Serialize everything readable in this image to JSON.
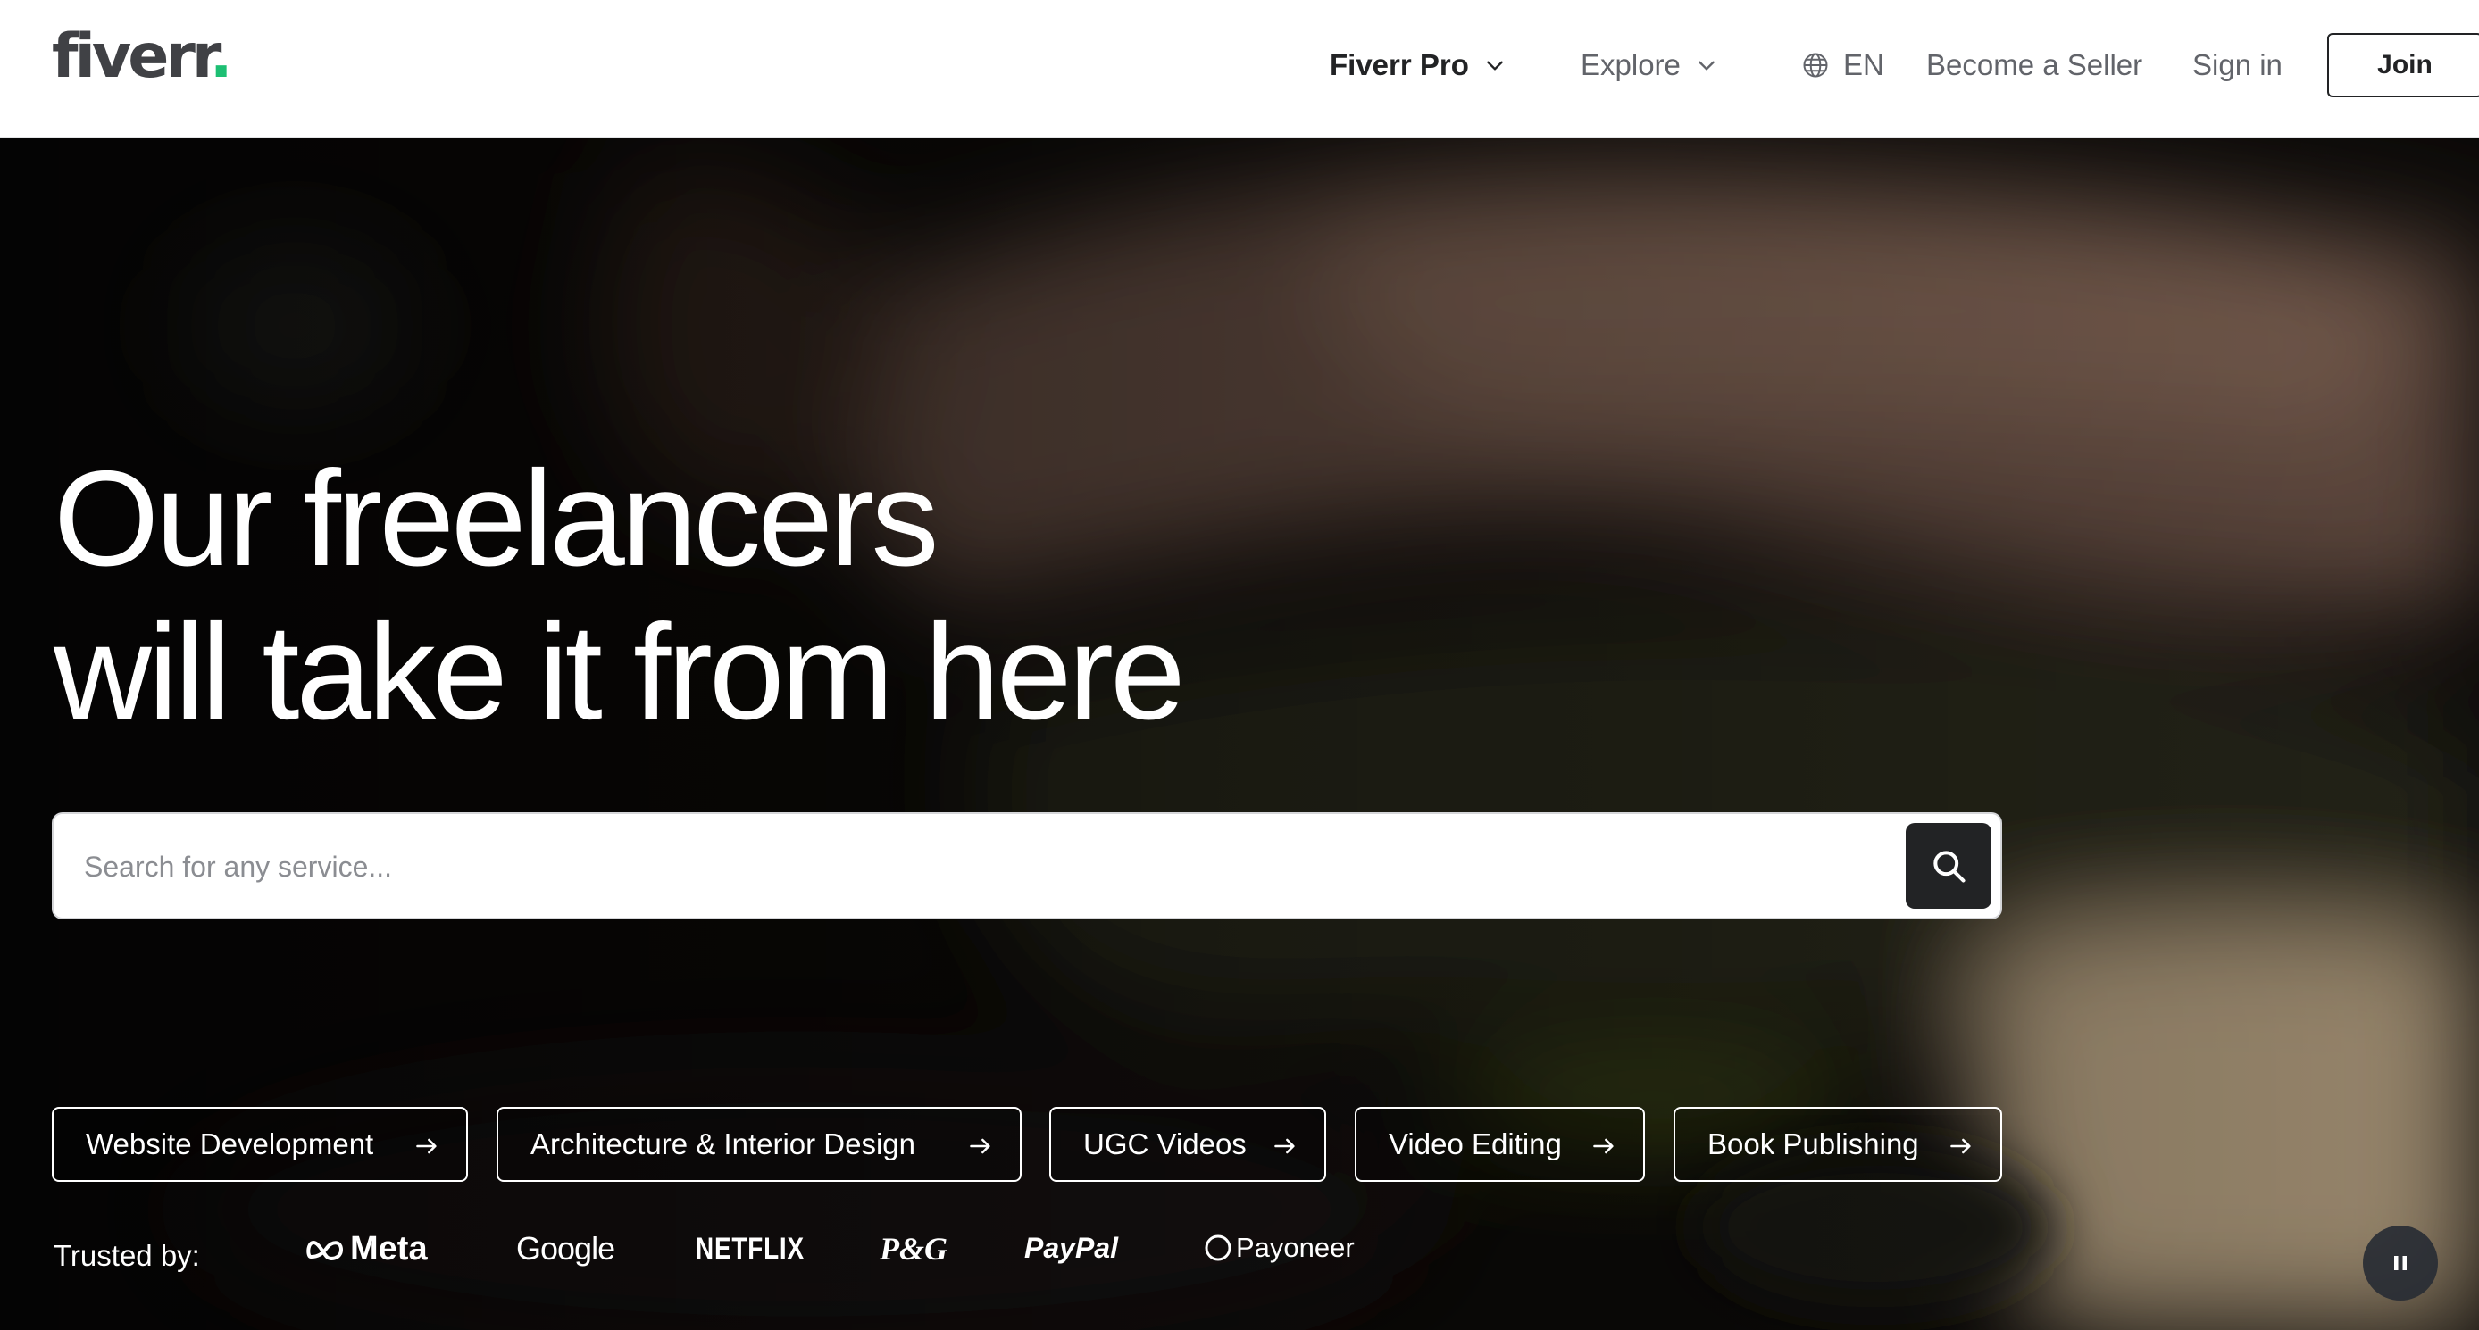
{
  "header": {
    "logo": {
      "text": "fiverr",
      "dot": "."
    },
    "nav": {
      "fiverr_pro": "Fiverr Pro",
      "explore": "Explore",
      "language": "EN",
      "become_seller": "Become a Seller",
      "sign_in": "Sign in",
      "join": "Join"
    }
  },
  "hero": {
    "headline": [
      "Our freelancers",
      "will take it from here"
    ],
    "search": {
      "placeholder": "Search for any service..."
    },
    "categories": [
      "Website Development",
      "Architecture & Interior Design",
      "UGC Videos",
      "Video Editing",
      "Book Publishing"
    ],
    "trusted": {
      "label": "Trusted by:",
      "brands": [
        "Meta",
        "Google",
        "NETFLIX",
        "P&G",
        "PayPal",
        "Payoneer"
      ]
    }
  },
  "colors": {
    "brand_green": "#1dbf73",
    "text_dark": "#222325",
    "text_gray": "#62646a",
    "hero_bg": "#0d0b09"
  },
  "icons": [
    "chevron-down-icon",
    "globe-icon",
    "search-icon",
    "arrow-right-icon",
    "meta-infinity-icon",
    "payoneer-circle-icon",
    "pause-icon"
  ]
}
